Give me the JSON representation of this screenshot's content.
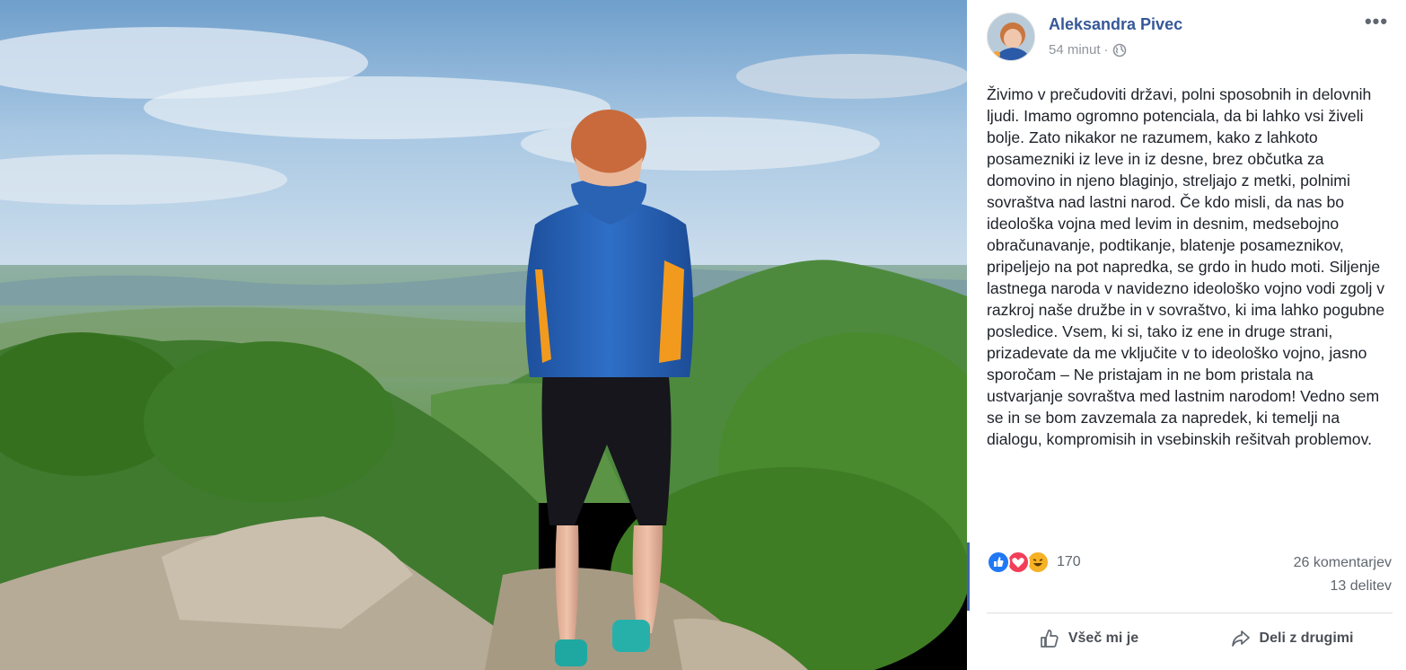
{
  "post": {
    "author": "Aleksandra Pivec",
    "time": "54 minut",
    "separator": "·",
    "privacy_icon": "globe-icon",
    "more_icon": "more-options-icon",
    "more_label": "•••",
    "text": "Živimo v prečudoviti državi, polni sposobnih in delovnih ljudi. Imamo ogromno potenciala, da bi lahko vsi živeli bolje. Zato nikakor ne razumem, kako z lahkoto posamezniki iz leve in iz desne, brez občutka za domovino in njeno blaginjo, streljajo z metki, polnimi sovraštva nad lastni narod. Če kdo misli, da nas bo ideološka vojna med levim in desnim, medsebojno obračunavanje, podtikanje, blatenje posameznikov, pripeljejo na pot napredka, se grdo in hudo moti. Siljenje lastnega naroda v navidezno ideološko vojno vodi zgolj v razkroj naše družbe in v sovraštvo, ki ima lahko pogubne posledice. Vsem, ki si, tako iz ene in druge strani, prizadevate da me vključite v to ideološko vojno, jasno sporočam – Ne pristajam in ne bom pristala na ustvarjanje sovraštva med lastnim narodom! Vedno sem se in se bom zavzemala za napredek, ki temelji na dialogu, kompromisih in vsebinskih rešitvah problemov."
  },
  "engagement": {
    "reaction_icons": [
      "like-icon",
      "love-icon",
      "haha-icon"
    ],
    "reaction_count": "170",
    "comments": "26 komentarjev",
    "shares": "13 delitev"
  },
  "actions": {
    "like_label": "Všeč mi je",
    "share_label": "Deli z drugimi"
  },
  "colors": {
    "author_link": "#365899",
    "like_blue": "#2078f4",
    "love_red": "#f33e58",
    "haha_yellow": "#f7b125"
  }
}
